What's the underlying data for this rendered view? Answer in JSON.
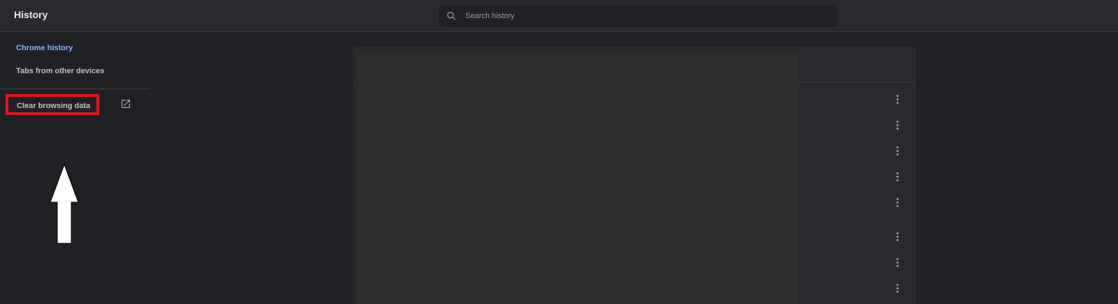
{
  "header": {
    "title": "History",
    "search": {
      "value": "",
      "placeholder": "Search history"
    }
  },
  "sidebar": {
    "items": [
      {
        "label": "Chrome history",
        "active": true
      },
      {
        "label": "Tabs from other devices",
        "active": false
      }
    ],
    "clear_browsing_data": {
      "label": "Clear browsing data",
      "icon": "external-link-icon",
      "highlight_color": "#e4141d"
    },
    "annotation_icon": "up-arrow-icon"
  },
  "history_list": {
    "more_actions_icon": "more-vert-icon",
    "row_count": 8
  },
  "colors": {
    "background": "#202124",
    "header": "#292a2d",
    "active_link": "#8ab4f8",
    "text": "#bdc1c6",
    "highlight": "#e4141d"
  }
}
